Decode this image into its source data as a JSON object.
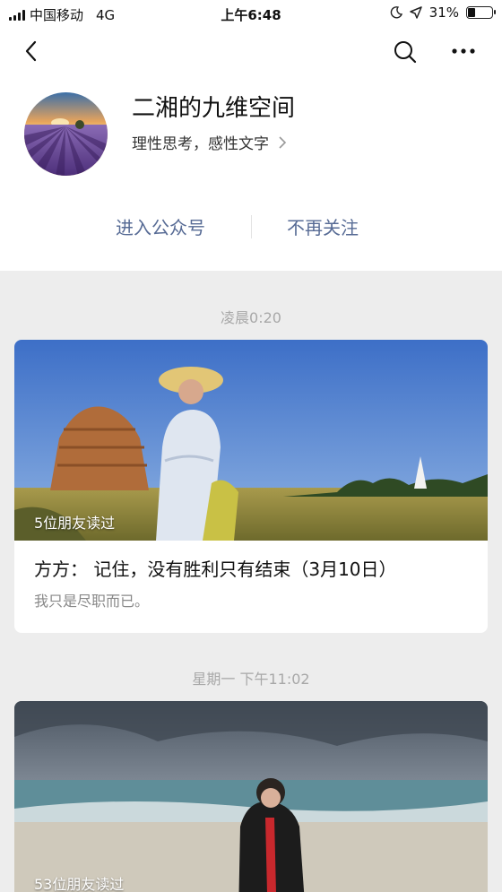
{
  "status_bar": {
    "carrier": "中国移动",
    "network": "4G",
    "time": "上午6:48",
    "battery_percent": "31%",
    "battery_level": 0.31,
    "icons": [
      "signal-icon",
      "moon-icon",
      "location-arrow-icon",
      "battery-icon"
    ]
  },
  "nav": {
    "icons": [
      "back-arrow-icon",
      "search-icon",
      "more-icon"
    ]
  },
  "account": {
    "name": "二湘的九维空间",
    "description": "理性思考，感性文字"
  },
  "actions": {
    "enter": "进入公众号",
    "unfollow": "不再关注"
  },
  "feed": [
    {
      "time": "凌晨0:20",
      "read_count": "5位朋友读过",
      "title": "方方：  记住，没有胜利只有结束（3月10日）",
      "digest": "我只是尽职而已。"
    },
    {
      "time": "星期一 下午11:02",
      "read_count": "53位朋友读过"
    }
  ],
  "colors": {
    "link_blue": "#576b95",
    "background": "#ededed",
    "card": "#ffffff"
  }
}
